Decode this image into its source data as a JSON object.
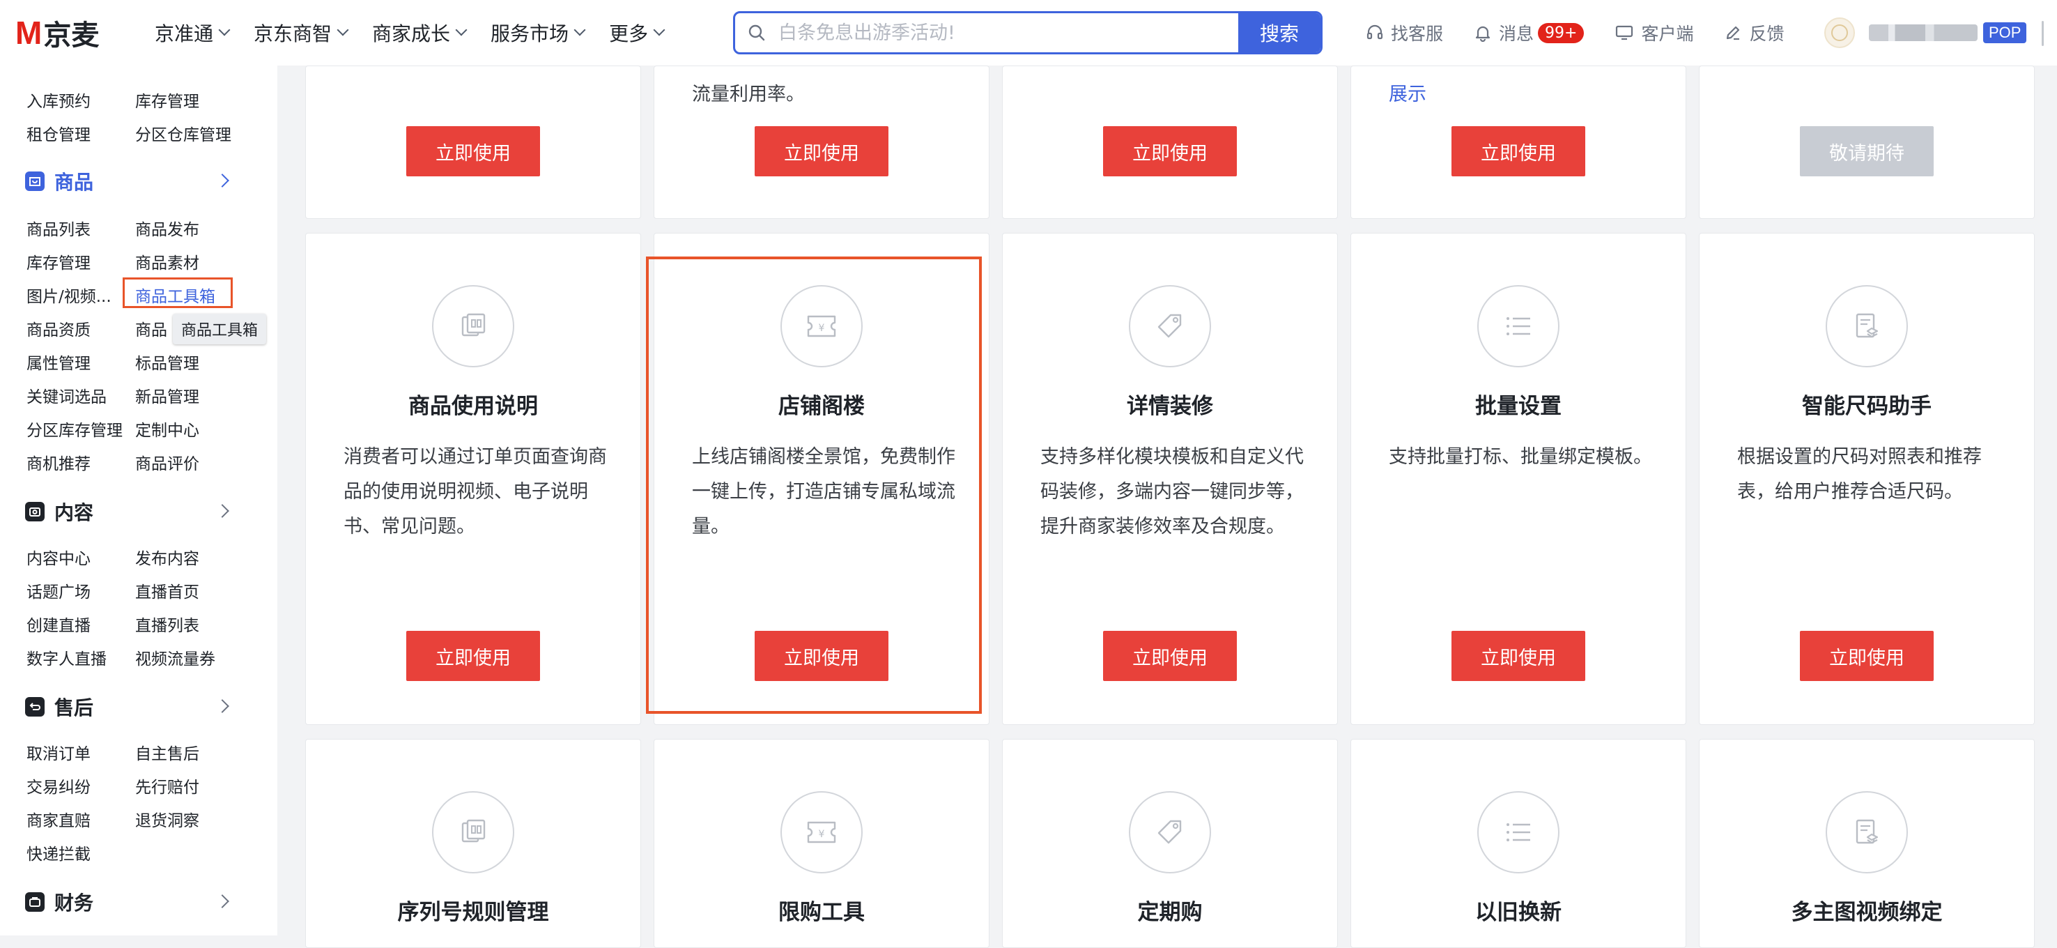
{
  "header": {
    "logo_mark": "M",
    "logo_text": "京麦",
    "nav": [
      "京准通",
      "京东商智",
      "商家成长",
      "服务市场",
      "更多"
    ],
    "search": {
      "placeholder": "白条免息出游季活动!",
      "button": "搜索"
    },
    "tools": [
      {
        "icon": "headset-icon",
        "label": "找客服"
      },
      {
        "icon": "bell-icon",
        "label": "消息",
        "badge": "99+"
      },
      {
        "icon": "monitor-icon",
        "label": "客户端"
      },
      {
        "icon": "edit-icon",
        "label": "反馈"
      }
    ],
    "user_tag": "POP"
  },
  "sidebar": {
    "top_links": [
      "入库预约",
      "库存管理",
      "租仓管理",
      "分区仓库管理"
    ],
    "sections": [
      {
        "title": "商品",
        "icon": "product-icon",
        "active": true,
        "links": [
          "商品列表",
          "商品发布",
          "库存管理",
          "商品素材",
          "图片/视频...",
          "商品工具箱",
          "商品资质",
          "商品",
          "属性管理",
          "标品管理",
          "关键词选品",
          "新品管理",
          "分区库存管理",
          "定制中心",
          "商机推荐",
          "商品评价"
        ]
      },
      {
        "title": "内容",
        "icon": "camera-icon",
        "links": [
          "内容中心",
          "发布内容",
          "话题广场",
          "直播首页",
          "创建直播",
          "直播列表",
          "数字人直播",
          "视频流量券"
        ]
      },
      {
        "title": "售后",
        "icon": "after-sale-icon",
        "links": [
          "取消订单",
          "自主售后",
          "交易纠纷",
          "先行赔付",
          "商家直赔",
          "退货洞察",
          "快递拦截"
        ]
      },
      {
        "title": "财务",
        "icon": "wallet-icon",
        "links": []
      }
    ],
    "tooltip": "商品工具箱"
  },
  "cards_top_row": [
    {
      "text": "",
      "button": "立即使用"
    },
    {
      "text": "流量利用率。",
      "button": "立即使用"
    },
    {
      "text": "",
      "button": "立即使用"
    },
    {
      "text": "展示",
      "text_is_link": true,
      "button": "立即使用"
    },
    {
      "text": "",
      "button": "敬请期待",
      "disabled": true
    }
  ],
  "cards_middle_row": [
    {
      "title": "商品使用说明",
      "icon": "manual-icon",
      "desc": "消费者可以通过订单页面查询商品的使用说明视频、电子说明书、常见问题。",
      "button": "立即使用"
    },
    {
      "title": "店铺阁楼",
      "icon": "coupon-icon",
      "desc": "上线店铺阁楼全景馆，免费制作 一键上传，打造店铺专属私域流量。",
      "button": "立即使用"
    },
    {
      "title": "详情装修",
      "icon": "tag-icon",
      "desc": "支持多样化模块模板和自定义代码装修，多端内容一键同步等，提升商家装修效率及合规度。",
      "button": "立即使用"
    },
    {
      "title": "批量设置",
      "icon": "list-icon",
      "desc": "支持批量打标、批量绑定模板。",
      "button": "立即使用"
    },
    {
      "title": "智能尺码助手",
      "icon": "document-icon",
      "desc": "根据设置的尺码对照表和推荐表，给用户推荐合适尺码。",
      "button": "立即使用"
    }
  ],
  "cards_bottom_row": [
    {
      "title": "序列号规则管理",
      "icon": "manual-icon"
    },
    {
      "title": "限购工具",
      "icon": "coupon-icon"
    },
    {
      "title": "定期购",
      "icon": "tag-icon"
    },
    {
      "title": "以旧换新",
      "icon": "list-icon"
    },
    {
      "title": "多主图视频绑定",
      "icon": "document-icon"
    }
  ]
}
